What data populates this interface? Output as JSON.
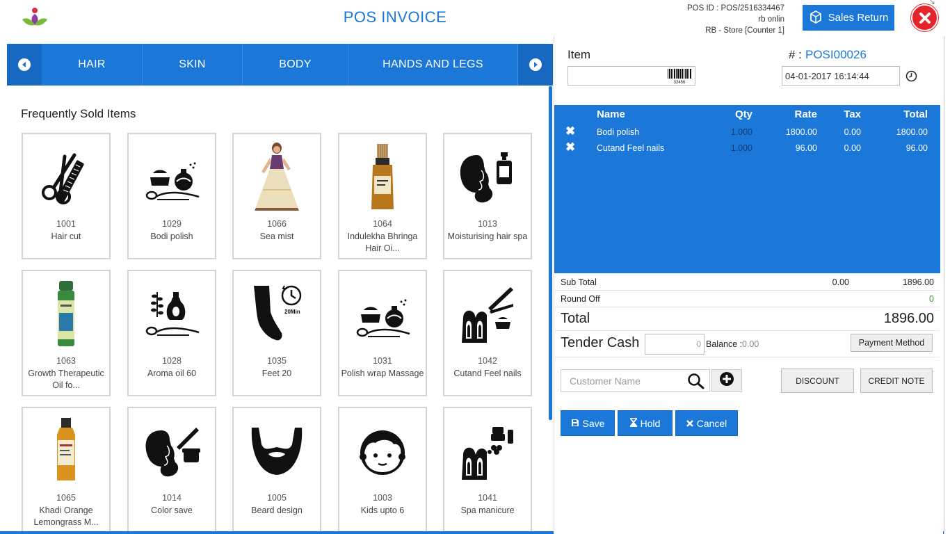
{
  "header": {
    "title": "POS INVOICE",
    "pos_id": "POS ID : POS/2516334467",
    "user": "rb onlin",
    "store": "RB - Store [Counter 1]",
    "sales_return_label": "Sales Return"
  },
  "categories": [
    "HAIR",
    "SKIN",
    "BODY",
    "HANDS AND LEGS"
  ],
  "frequent_title": "Frequently Sold Items",
  "products": [
    {
      "code": "1001",
      "name": "Hair cut"
    },
    {
      "code": "1029",
      "name": "Bodi polish"
    },
    {
      "code": "1066",
      "name": "Sea mist"
    },
    {
      "code": "1064",
      "name": "Indulekha Bhringa Hair Oi..."
    },
    {
      "code": "1013",
      "name": "Moisturising hair spa"
    },
    {
      "code": "1063",
      "name": "Growth Therapeutic Oil fo..."
    },
    {
      "code": "1028",
      "name": "Aroma oil 60"
    },
    {
      "code": "1035",
      "name": "Feet 20"
    },
    {
      "code": "1031",
      "name": "Polish wrap Massage"
    },
    {
      "code": "1042",
      "name": "Cutand Feel nails"
    },
    {
      "code": "1065",
      "name": "Khadi Orange Lemongrass M..."
    },
    {
      "code": "1014",
      "name": "Color save"
    },
    {
      "code": "1005",
      "name": "Beard design"
    },
    {
      "code": "1003",
      "name": "Kids upto 6"
    },
    {
      "code": "1041",
      "name": "Spa manicure"
    }
  ],
  "invoice": {
    "item_label": "Item",
    "barcode_text": "32456",
    "number_label": "# :",
    "number": "POSI00026",
    "date": "04-01-2017 16:14:44"
  },
  "table": {
    "headers": {
      "name": "Name",
      "qty": "Qty",
      "rate": "Rate",
      "tax": "Tax",
      "total": "Total"
    },
    "rows": [
      {
        "remove": "✖",
        "name": "Bodi polish",
        "qty": "1.000",
        "rate": "1800.00",
        "tax": "0.00",
        "total": "1800.00"
      },
      {
        "remove": "✖",
        "name": "Cutand Feel nails",
        "qty": "1.000",
        "rate": "96.00",
        "tax": "0.00",
        "total": "96.00"
      }
    ]
  },
  "summary": {
    "subtotal_label": "Sub Total",
    "subtotal_tax": "0.00",
    "subtotal": "1896.00",
    "roundoff_label": "Round Off",
    "roundoff": "0",
    "total_label": "Total",
    "total": "1896.00",
    "tender_label": "Tender Cash",
    "tender_value": "0",
    "balance_label": "Balance :",
    "balance": "0.00",
    "payment_method_label": "Payment Method"
  },
  "customer": {
    "placeholder": "Customer Name",
    "discount_label": "DISCOUNT",
    "credit_note_label": "CREDIT NOTE"
  },
  "actions": {
    "save": "Save",
    "hold": "Hold",
    "cancel": "Cancel"
  },
  "colors": {
    "accent": "#1b78d8",
    "danger": "#e5252a",
    "roundoff_green": "#3a9a2a"
  }
}
